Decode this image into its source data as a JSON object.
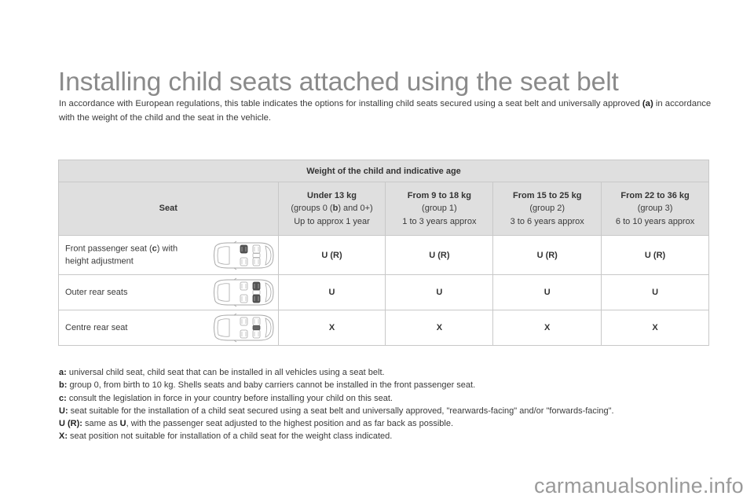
{
  "title": "Installing child seats attached using the seat belt",
  "intro": {
    "text_before": "In accordance with European regulations, this table indicates the options for installing child seats secured using a seat belt and universally approved ",
    "ref": "(a)",
    "text_after": " in accordance with the weight of the child and the seat in the vehicle."
  },
  "table": {
    "group_header": "Weight of the child and indicative age",
    "seat_header": "Seat",
    "columns": [
      {
        "weight": "Under 13 kg",
        "group_prefix": "(groups 0 (",
        "group_ref": "b",
        "group_suffix": ") and 0+)",
        "age": "Up to approx 1 year"
      },
      {
        "weight": "From 9 to 18 kg",
        "group": "(group 1)",
        "age": "1 to 3 years approx"
      },
      {
        "weight": "From 15 to 25 kg",
        "group": "(group 2)",
        "age": "3 to 6 years approx"
      },
      {
        "weight": "From 22 to 36 kg",
        "group": "(group 3)",
        "age": "6 to 10 years approx"
      }
    ],
    "rows": [
      {
        "seat_prefix": "Front passenger seat (",
        "seat_ref": "c",
        "seat_suffix": ") with height adjustment",
        "icon": "car-front-passenger-seat-icon",
        "values": [
          "U (R)",
          "U (R)",
          "U (R)",
          "U (R)"
        ]
      },
      {
        "seat": "Outer rear seats",
        "icon": "car-outer-rear-seats-icon",
        "values": [
          "U",
          "U",
          "U",
          "U"
        ]
      },
      {
        "seat": "Centre rear seat",
        "icon": "car-centre-rear-seat-icon",
        "values": [
          "X",
          "X",
          "X",
          "X"
        ]
      }
    ]
  },
  "notes": [
    {
      "key": "a:",
      "text": " universal child seat, child seat that can be installed in all vehicles using a seat belt."
    },
    {
      "key": "b:",
      "text": " group 0, from birth to 10 kg. Shells seats and baby carriers cannot be installed in the front passenger seat."
    },
    {
      "key": "c:",
      "text": " consult the legislation in force in your country before installing your child on this seat."
    },
    {
      "key": "U:",
      "text": " seat suitable for the installation of a child seat secured using a seat belt and universally approved, \"rearwards-facing\" and/or \"forwards-facing\"."
    },
    {
      "key": "U (R):",
      "text_before": " same as ",
      "bold": "U",
      "text": ", with the passenger seat adjusted to the highest position and as far back as possible."
    },
    {
      "key": "X:",
      "text": " seat position not suitable for installation of a child seat for the weight class indicated."
    }
  ],
  "watermark": "carmanualsonline.info"
}
